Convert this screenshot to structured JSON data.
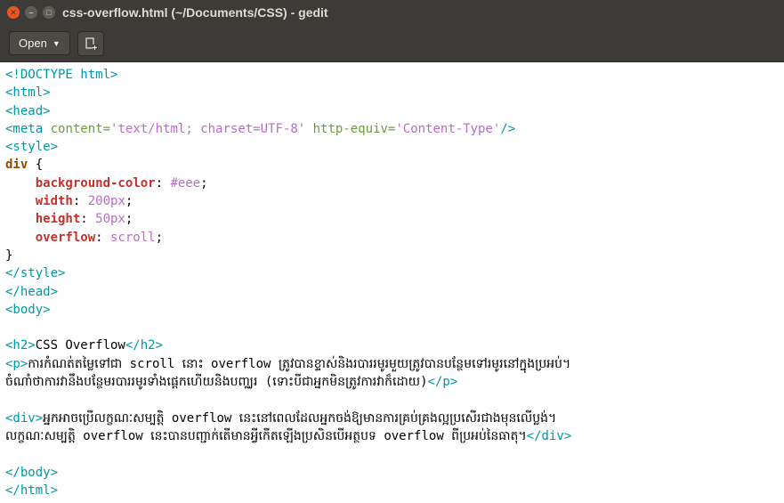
{
  "window": {
    "title": "css-overflow.html (~/Documents/CSS) - gedit"
  },
  "toolbar": {
    "open_label": "Open"
  },
  "code": {
    "l1_doctype": "<!DOCTYPE html>",
    "l2_html_open": "<html>",
    "l3_head_open": "<head>",
    "l4": {
      "meta_open": "<meta",
      "attr_content": " content",
      "eq1": "=",
      "val_content": "'text/html; charset=UTF-8'",
      "attr_httpequiv": " http-equiv",
      "eq2": "=",
      "val_httpequiv": "'Content-Type'",
      "meta_close": "/>"
    },
    "l5_style_open": "<style>",
    "l6": {
      "sel": "div",
      "brace": " {"
    },
    "l7": {
      "pad": "    ",
      "prop": "background-color",
      "colon": ": ",
      "val": "#eee",
      "semi": ";"
    },
    "l8": {
      "pad": "    ",
      "prop": "width",
      "colon": ": ",
      "val": "200px",
      "semi": ";"
    },
    "l9": {
      "pad": "    ",
      "prop": "height",
      "colon": ": ",
      "val": "50px",
      "semi": ";"
    },
    "l10": {
      "pad": "    ",
      "prop": "overflow",
      "colon": ": ",
      "val": "scroll",
      "semi": ";"
    },
    "l11_brace_close": "}",
    "l12_style_close": "</style>",
    "l13_head_close": "</head>",
    "l14_body_open": "<body>",
    "blank1": "",
    "l16": {
      "h2_open": "<h2>",
      "text": "CSS Overflow",
      "h2_close": "</h2>"
    },
    "l17": {
      "p_open": "<p>",
      "text": "ការកំណត់តម្លៃទៅជា scroll នោះ overflow ត្រូវបានខ្ទាស់និងរបាររមូរមួយត្រូវបានបន្ថែមទៅរមូរនៅក្នុងប្រអប់។"
    },
    "l17b": {
      "text": "ចំណាំថាការវានឹងបន្ថែមរបាររមូរទាំងផ្ដេកហើយនិងបញ្ឈរ (ទោះបីជាអ្នកមិនត្រូវការវាក៏ដោយ)",
      "p_close": "</p>"
    },
    "blank2": "",
    "l19": {
      "div_open": "<div>",
      "text": "អ្នកអាចប្រើលក្ខណៈសម្បត្តិ overflow នេះនៅពេលដែលអ្នកចង់ឱ្យមានការគ្រប់គ្រងល្អប្រសើរជាងមុនលើប្លង់។"
    },
    "l19b": {
      "text": "លក្ខណៈសម្បត្តិ overflow នេះបានបញ្ជាក់តើមានអ្វីកើតឡើងប្រសិនបើអត្ថបទ overflow ពីប្រអប់នៃធាតុ។",
      "div_close": "</div>"
    },
    "blank3": "",
    "l21_body_close": "</body>",
    "l22_html_close": "</html>"
  }
}
